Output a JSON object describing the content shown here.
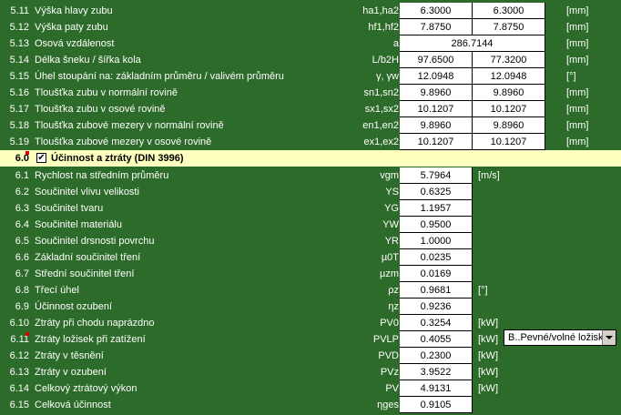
{
  "rows_5": [
    {
      "num": "5.11",
      "desc": "Výška hlavy zubu",
      "sym": "ha1,ha2",
      "v1": "6.3000",
      "v2": "6.3000",
      "unit": "[mm]"
    },
    {
      "num": "5.12",
      "desc": "Výška paty zubu",
      "sym": "hf1,hf2",
      "v1": "7.8750",
      "v2": "7.8750",
      "unit": "[mm]"
    },
    {
      "num": "5.13",
      "desc": "Osová vzdálenost",
      "sym": "a",
      "wide": "286.7144",
      "unit": "[mm]"
    },
    {
      "num": "5.14",
      "desc": "Délka šneku / šířka kola",
      "sym": "L/b2H",
      "v1": "97.6500",
      "v2": "77.3200",
      "unit": "[mm]"
    },
    {
      "num": "5.15",
      "desc": "Úhel stoupání na:  základním průměru / valivém průměru",
      "sym": "γ, γw",
      "v1": "12.0948",
      "v2": "12.0948",
      "unit": "[°]"
    },
    {
      "num": "5.16",
      "desc": "Tloušťka zubu v normální rovině",
      "sym": "sn1,sn2",
      "v1": "9.8960",
      "v2": "9.8960",
      "unit": "[mm]"
    },
    {
      "num": "5.17",
      "desc": "Tloušťka zubu v osové rovině",
      "sym": "sx1,sx2",
      "v1": "10.1207",
      "v2": "10.1207",
      "unit": "[mm]"
    },
    {
      "num": "5.18",
      "desc": "Tloušťka zubové mezery v normální rovině",
      "sym": "en1,en2",
      "v1": "9.8960",
      "v2": "9.8960",
      "unit": "[mm]"
    },
    {
      "num": "5.19",
      "desc": "Tloušťka zubové mezery v osové rovině",
      "sym": "ex1,ex2",
      "v1": "10.1207",
      "v2": "10.1207",
      "unit": "[mm]"
    }
  ],
  "section6": {
    "num": "6.0",
    "title": "Účinnost a ztráty (DIN 3996)",
    "checkbox": "✔"
  },
  "rows_6": [
    {
      "num": "6.1",
      "desc": "Rychlost na středním průměru",
      "sym": "vgm",
      "v1": "5.7964",
      "unit": "[m/s]"
    },
    {
      "num": "6.2",
      "desc": "Součinitel vlivu velikosti",
      "sym": "YS",
      "v1": "0.6325",
      "unit": ""
    },
    {
      "num": "6.3",
      "desc": "Součinitel tvaru",
      "sym": "YG",
      "v1": "1.1957",
      "unit": ""
    },
    {
      "num": "6.4",
      "desc": "Součinitel materiálu",
      "sym": "YW",
      "v1": "0.9500",
      "unit": ""
    },
    {
      "num": "6.5",
      "desc": "Součinitel drsnosti povrchu",
      "sym": "YR",
      "v1": "1.0000",
      "unit": ""
    },
    {
      "num": "6.6",
      "desc": "Základní součinitel tření",
      "sym": "µ0T",
      "v1": "0.0235",
      "unit": ""
    },
    {
      "num": "6.7",
      "desc": "Střední součinitel tření",
      "sym": "µzm",
      "v1": "0.0169",
      "unit": ""
    },
    {
      "num": "6.8",
      "desc": "Třecí úhel",
      "sym": "ρz",
      "v1": "0.9681",
      "unit": "[°]"
    },
    {
      "num": "6.9",
      "desc": "Účinnost ozubení",
      "sym": "ηz",
      "v1": "0.9236",
      "unit": ""
    },
    {
      "num": "6.10",
      "desc": "Ztráty při chodu naprázdno",
      "sym": "PV0",
      "v1": "0.3254",
      "unit": "[kW]"
    },
    {
      "num": "6.11",
      "desc": "Ztráty ložisek při zatížení",
      "sym": "PVLP",
      "v1": "0.4055",
      "unit": "[kW]"
    },
    {
      "num": "6.12",
      "desc": "Ztráty v těsnění",
      "sym": "PVD",
      "v1": "0.2300",
      "unit": "[kW]"
    },
    {
      "num": "6.13",
      "desc": "Ztráty v ozubení",
      "sym": "PVz",
      "v1": "3.9522",
      "unit": "[kW]"
    },
    {
      "num": "6.14",
      "desc": "Celkový ztrátový výkon",
      "sym": "PV",
      "v1": "4.9131",
      "unit": "[kW]"
    },
    {
      "num": "6.15",
      "desc": "Celková účinnost",
      "sym": "ηges",
      "v1": "0.9105",
      "unit": ""
    }
  ],
  "bearing_select": {
    "value": "B..Pevné/volné ložisko"
  }
}
